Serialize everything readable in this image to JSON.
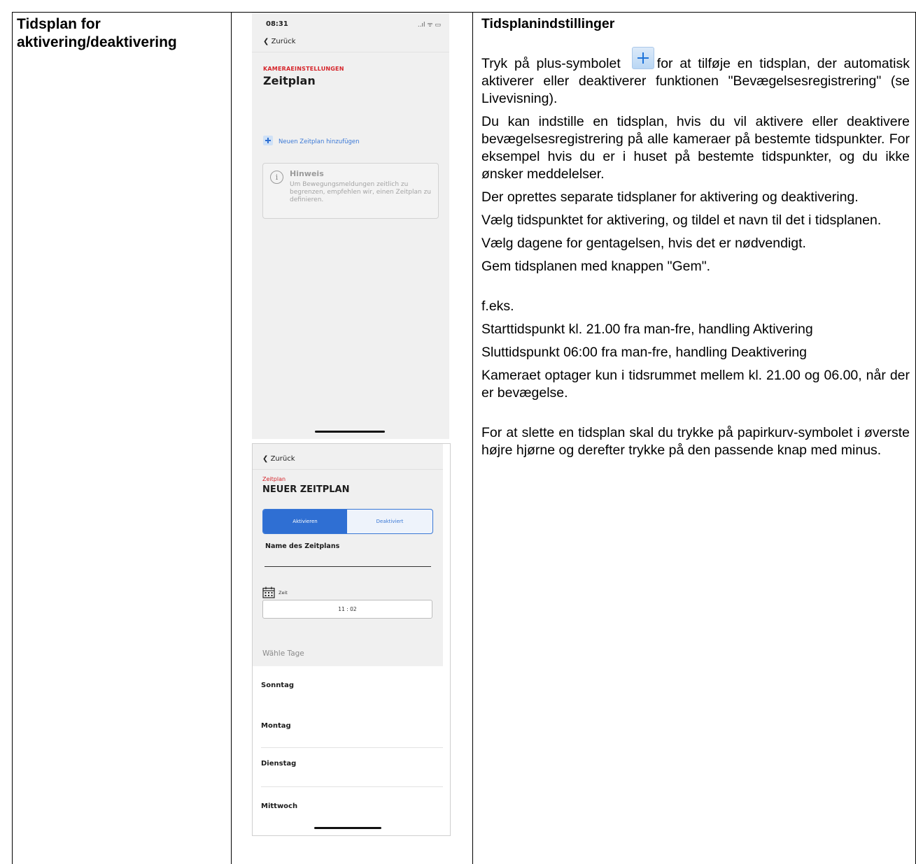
{
  "left_cell": {
    "title": "Tidsplan for aktivering/deaktivering"
  },
  "phone1": {
    "time": "08:31",
    "status_icons": "..ıl ᯤ ▭",
    "back_label": "Zurück",
    "overline": "KAMERAEINSTELLUNGEN",
    "title": "Zeitplan",
    "add_label": "Neuen Zeitplan hinzufügen",
    "hint": {
      "icon": "i",
      "title": "Hinweis",
      "body": "Um Bewegungsmeldungen zeitlich zu begrenzen, empfehlen wir, einen Zeitplan zu definieren."
    }
  },
  "phone2": {
    "back_label": "Zurück",
    "overline": "Zeitplan",
    "title": "NEUER ZEITPLAN",
    "segment": {
      "active": "Aktivieren",
      "inactive": "Deaktiviert"
    },
    "name_label": "Name des Zeitplans",
    "zeit_label": "Zeit",
    "time_value": "11 : 02",
    "days_label": "Wähle Tage",
    "days": [
      "Sonntag",
      "Montag",
      "Dienstag",
      "Mittwoch"
    ]
  },
  "right_cell": {
    "heading": "Tidsplanindstillinger",
    "p1_before": "Tryk på plus-symbolet",
    "p1_after": "for at tilføje en tidsplan, der automatisk aktiverer eller deaktiverer funktionen \"Bevægelsesregistrering\" (se Livevisning).",
    "p2": "Du kan indstille en tidsplan, hvis du vil aktivere eller deaktivere bevægelsesregistrering på alle kameraer på bestemte tidspunkter. For eksempel hvis du er i huset på bestemte tidspunkter, og du ikke ønsker meddelelser.",
    "p3": "Der oprettes separate tidsplaner for aktivering og deaktivering.",
    "p4": "Vælg tidspunktet for aktivering, og tildel et navn til det i tidsplanen.",
    "p5": "Vælg dagene for gentagelsen, hvis det er nødvendigt.",
    "p6": "Gem tidsplanen med knappen \"Gem\".",
    "example_label": "f.eks.",
    "example_1": "Starttidspunkt kl. 21.00 fra man-fre, handling Aktivering",
    "example_2": "Sluttidspunkt 06:00 fra man-fre, handling Deaktivering",
    "example_3": "Kameraet optager kun i tidsrummet mellem kl. 21.00 og 06.00, når der er bevægelse.",
    "p_delete": "For at slette en tidsplan skal du trykke på papirkurv-symbolet i øverste højre hjørne og derefter trykke på den passende knap med minus."
  }
}
